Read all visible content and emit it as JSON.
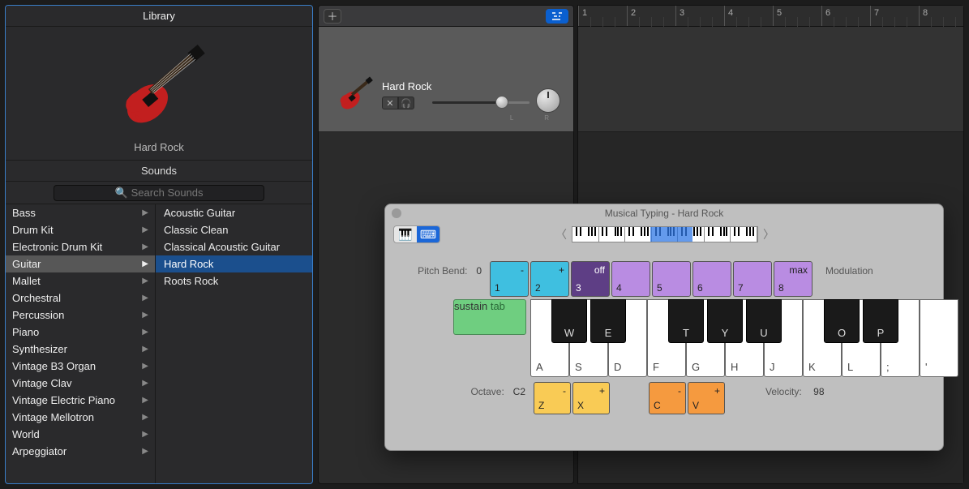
{
  "library": {
    "title": "Library",
    "preview_name": "Hard Rock",
    "sounds_header": "Sounds",
    "search_placeholder": "Search Sounds",
    "categories": [
      "Bass",
      "Drum Kit",
      "Electronic Drum Kit",
      "Guitar",
      "Mallet",
      "Orchestral",
      "Percussion",
      "Piano",
      "Synthesizer",
      "Vintage B3 Organ",
      "Vintage Clav",
      "Vintage Electric Piano",
      "Vintage Mellotron",
      "World",
      "Arpeggiator"
    ],
    "selected_category_index": 3,
    "presets": [
      "Acoustic Guitar",
      "Classic Clean",
      "Classical Acoustic Guitar",
      "Hard Rock",
      "Roots Rock"
    ],
    "selected_preset_index": 3
  },
  "track": {
    "name": "Hard Rock",
    "mute_icon": "mute-icon",
    "solo_icon": "headphones-icon",
    "pan_lr": "L R"
  },
  "timeline": {
    "bars": [
      1,
      2,
      3,
      4,
      5,
      6,
      7,
      8
    ]
  },
  "musical_typing": {
    "window_title": "Musical Typing - Hard Rock",
    "pitch_bend_label": "Pitch Bend:",
    "pitch_bend_value": "0",
    "modulation_label": "Modulation",
    "octave_label": "Octave:",
    "octave_value": "C2",
    "velocity_label": "Velocity:",
    "velocity_value": "98",
    "keys_pitch": [
      {
        "top": "-",
        "bot": "1",
        "cls": "bcyan"
      },
      {
        "top": "+",
        "bot": "2",
        "cls": "bcyan"
      },
      {
        "top": "off",
        "bot": "3",
        "cls": "bpurD"
      },
      {
        "top": "",
        "bot": "4",
        "cls": "bpurL"
      },
      {
        "top": "",
        "bot": "5",
        "cls": "bpurL"
      },
      {
        "top": "",
        "bot": "6",
        "cls": "bpurL"
      },
      {
        "top": "",
        "bot": "7",
        "cls": "bpurL"
      },
      {
        "top": "max",
        "bot": "8",
        "cls": "bpurL"
      }
    ],
    "sustain": {
      "top": "sustain",
      "bot": "tab"
    },
    "white_keys": [
      "A",
      "S",
      "D",
      "F",
      "G",
      "H",
      "J",
      "K",
      "L",
      ";",
      "'"
    ],
    "black_keys": [
      {
        "label": "W",
        "slot": 0
      },
      {
        "label": "E",
        "slot": 1
      },
      {
        "label": "T",
        "slot": 3
      },
      {
        "label": "Y",
        "slot": 4
      },
      {
        "label": "U",
        "slot": 5
      },
      {
        "label": "O",
        "slot": 7
      },
      {
        "label": "P",
        "slot": 8
      }
    ],
    "oct_keys": [
      {
        "top": "-",
        "bot": "Z",
        "cls": "byel"
      },
      {
        "top": "+",
        "bot": "X",
        "cls": "byel"
      },
      {
        "top": "-",
        "bot": "C",
        "cls": "borg",
        "gap": true
      },
      {
        "top": "+",
        "bot": "V",
        "cls": "borg"
      }
    ]
  }
}
